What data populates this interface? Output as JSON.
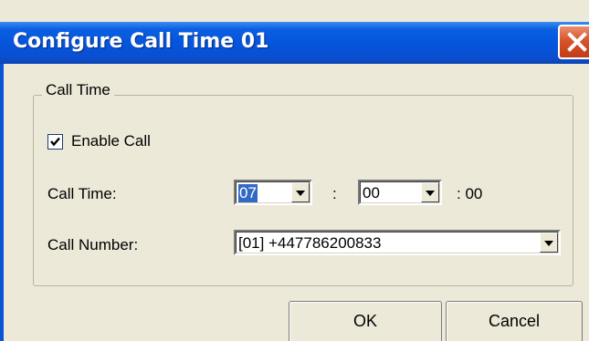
{
  "window": {
    "title": "Configure Call Time 01"
  },
  "group": {
    "legend": "Call Time"
  },
  "enable_call": {
    "label": "Enable Call",
    "checked": true
  },
  "call_time": {
    "label": "Call Time:",
    "hour": "07",
    "minute": "00",
    "separator": ":",
    "seconds": ": 00"
  },
  "call_number": {
    "label": "Call Number:",
    "value": "[01] +447786200833"
  },
  "buttons": {
    "ok": "OK",
    "cancel": "Cancel"
  },
  "icons": {
    "close": "close-icon",
    "dropdown": "chevron-down-icon",
    "check": "check-icon"
  },
  "colors": {
    "titlebar": "#0554dc",
    "close_button": "#d8542b",
    "selection": "#316ac5",
    "dialog_face": "#ece9d8"
  }
}
